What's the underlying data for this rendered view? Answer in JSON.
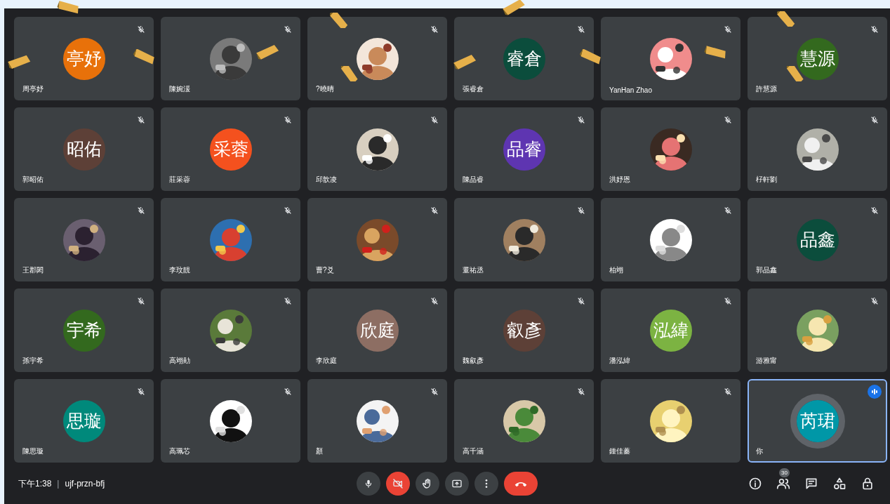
{
  "tiles": [
    {
      "name": "周亭妤",
      "avatar": {
        "kind": "initials",
        "text": "亭妤",
        "color": "#e8710a"
      },
      "muted": true,
      "speaking": false
    },
    {
      "name": "陳婉湲",
      "muted": true,
      "speaking": false
    },
    {
      "name": "?曉晴",
      "muted": true,
      "speaking": false
    },
    {
      "name": "張睿倉",
      "avatar": {
        "kind": "initials",
        "text": "睿倉",
        "color": "#0b4d3c"
      },
      "muted": true,
      "speaking": false
    },
    {
      "name": "YanHan Zhao",
      "muted": true,
      "speaking": false
    },
    {
      "name": "許慧源",
      "avatar": {
        "kind": "initials",
        "text": "慧源",
        "color": "#33691e"
      },
      "muted": true,
      "speaking": false
    },
    {
      "name": "郭昭佑",
      "avatar": {
        "kind": "initials",
        "text": "昭佑",
        "color": "#5d4037"
      },
      "muted": true,
      "speaking": false
    },
    {
      "name": "莊采蓉",
      "avatar": {
        "kind": "initials",
        "text": "采蓉",
        "color": "#f4511e"
      },
      "muted": true,
      "speaking": false
    },
    {
      "name": "邱歆凌",
      "muted": true,
      "speaking": false
    },
    {
      "name": "陳品睿",
      "avatar": {
        "kind": "initials",
        "text": "品睿",
        "color": "#5e35b1"
      },
      "muted": true,
      "speaking": false
    },
    {
      "name": "洪妤恩",
      "muted": true,
      "speaking": false
    },
    {
      "name": "杍軒劉",
      "muted": true,
      "speaking": false
    },
    {
      "name": "王郡閎",
      "muted": true,
      "speaking": false
    },
    {
      "name": "李玟靚",
      "muted": true,
      "speaking": false
    },
    {
      "name": "曹?爻",
      "muted": true,
      "speaking": false
    },
    {
      "name": "董祐丞",
      "muted": true,
      "speaking": false
    },
    {
      "name": "柏翊",
      "muted": true,
      "speaking": false
    },
    {
      "name": "郭品鑫",
      "avatar": {
        "kind": "initials",
        "text": "品鑫",
        "color": "#0b4d3c"
      },
      "muted": true,
      "speaking": false
    },
    {
      "name": "孫宇希",
      "avatar": {
        "kind": "initials",
        "text": "宇希",
        "color": "#33691e"
      },
      "muted": true,
      "speaking": false
    },
    {
      "name": "高翊勛",
      "muted": true,
      "speaking": false
    },
    {
      "name": "李欣庭",
      "avatar": {
        "kind": "initials",
        "text": "欣庭",
        "color": "#8d6e63"
      },
      "muted": true,
      "speaking": false
    },
    {
      "name": "魏叡彥",
      "avatar": {
        "kind": "initials",
        "text": "叡彥",
        "color": "#5d4037"
      },
      "muted": true,
      "speaking": false
    },
    {
      "name": "潘泓緯",
      "avatar": {
        "kind": "initials",
        "text": "泓緯",
        "color": "#7cb342"
      },
      "muted": true,
      "speaking": false
    },
    {
      "name": "游雅甯",
      "muted": true,
      "speaking": false
    },
    {
      "name": "陳思璇",
      "avatar": {
        "kind": "initials",
        "text": "思璇",
        "color": "#00897b"
      },
      "muted": true,
      "speaking": false
    },
    {
      "name": "高珮芯",
      "muted": true,
      "speaking": false
    },
    {
      "name": "顏",
      "muted": true,
      "speaking": false
    },
    {
      "name": "高千涵",
      "muted": true,
      "speaking": false
    },
    {
      "name": "鍾佳蓁",
      "muted": true,
      "speaking": false
    },
    {
      "name": "你",
      "avatar": {
        "kind": "initials",
        "text": "芮珺",
        "color": "#0097a7"
      },
      "muted": false,
      "speaking": true
    }
  ],
  "bottom_bar": {
    "time": "下午1:38",
    "separator": "|",
    "meeting_code": "ujf-przn-bfj",
    "camera_off": true,
    "participant_count": "30"
  }
}
